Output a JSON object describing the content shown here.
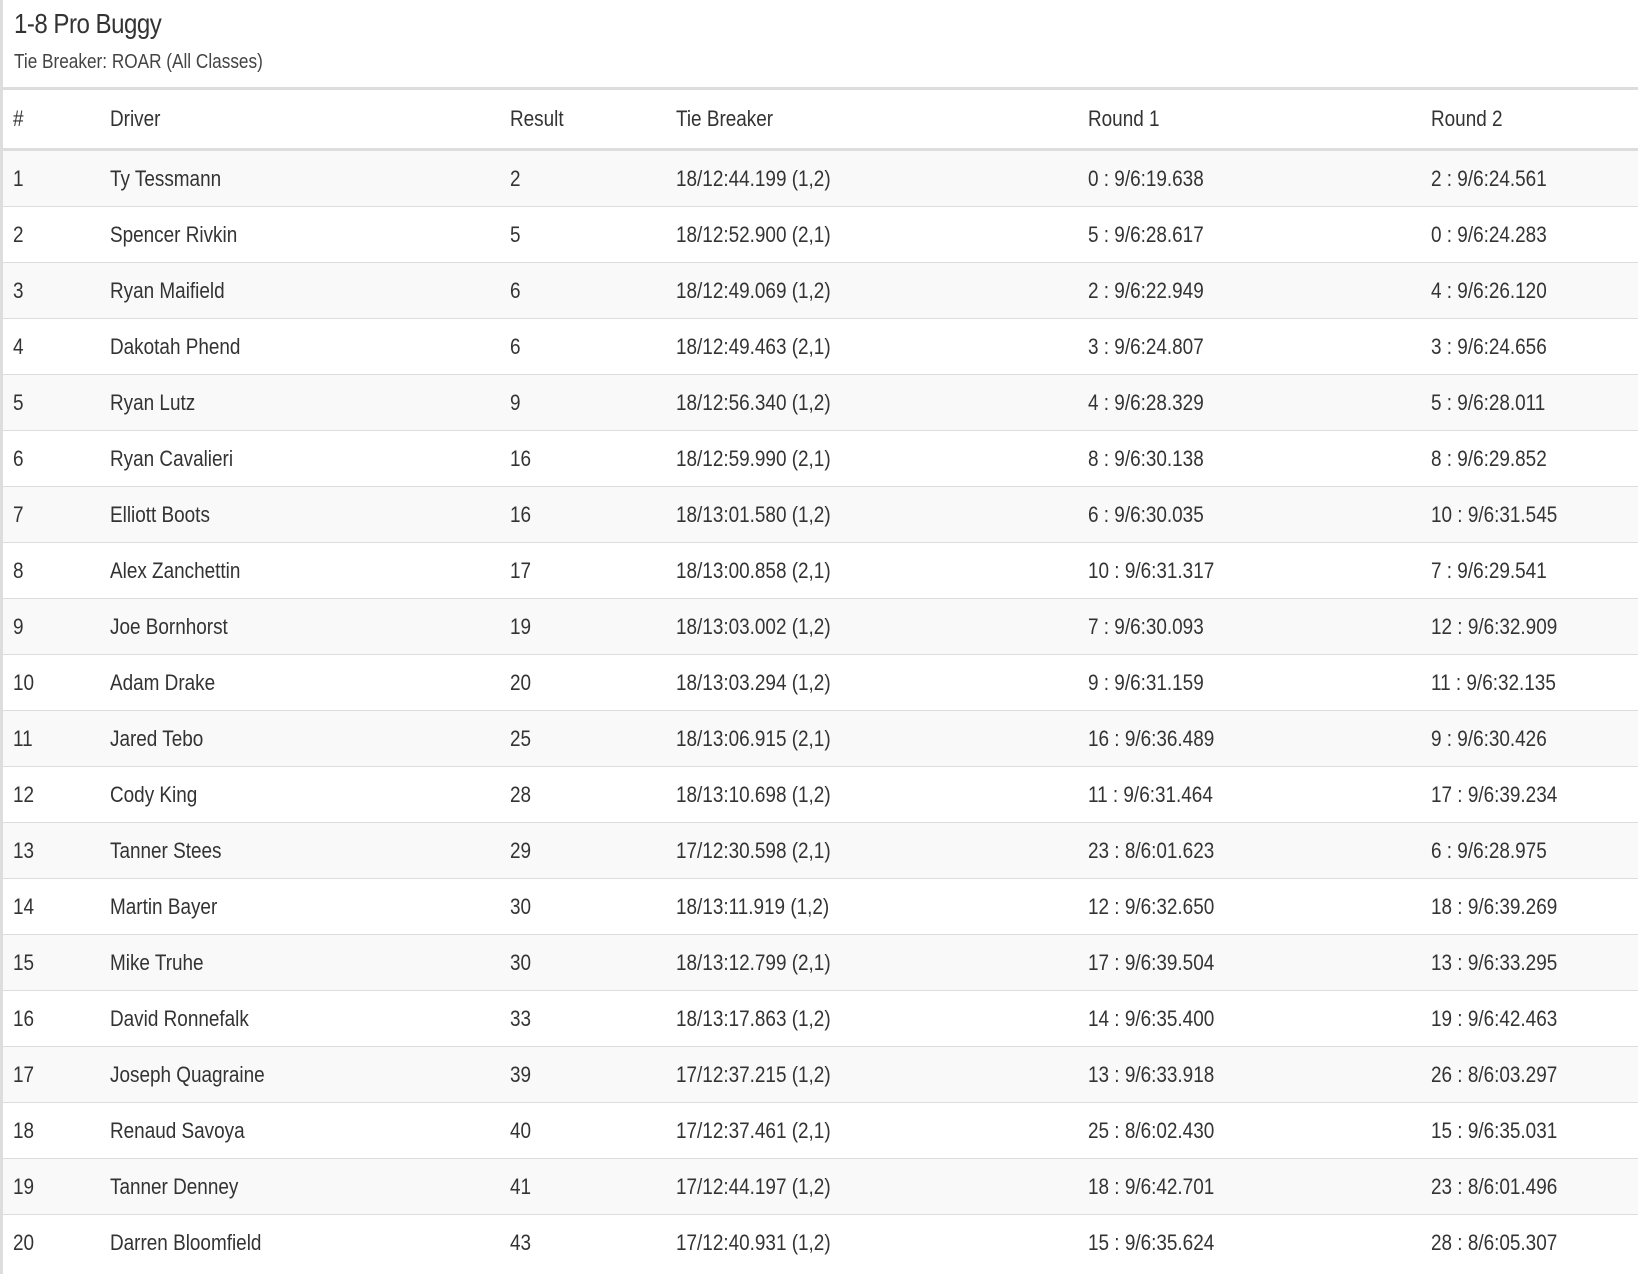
{
  "header": {
    "title": "1-8 Pro Buggy",
    "subtitle": "Tie Breaker: ROAR (All Classes)"
  },
  "table": {
    "columns": [
      "#",
      "Driver",
      "Result",
      "Tie Breaker",
      "Round 1",
      "Round 2"
    ],
    "rows": [
      [
        "1",
        "Ty Tessmann",
        "2",
        "18/12:44.199 (1,2)",
        "0 : 9/6:19.638",
        "2 : 9/6:24.561"
      ],
      [
        "2",
        "Spencer Rivkin",
        "5",
        "18/12:52.900 (2,1)",
        "5 : 9/6:28.617",
        "0 : 9/6:24.283"
      ],
      [
        "3",
        "Ryan Maifield",
        "6",
        "18/12:49.069 (1,2)",
        "2 : 9/6:22.949",
        "4 : 9/6:26.120"
      ],
      [
        "4",
        "Dakotah Phend",
        "6",
        "18/12:49.463 (2,1)",
        "3 : 9/6:24.807",
        "3 : 9/6:24.656"
      ],
      [
        "5",
        "Ryan Lutz",
        "9",
        "18/12:56.340 (1,2)",
        "4 : 9/6:28.329",
        "5 : 9/6:28.011"
      ],
      [
        "6",
        "Ryan Cavalieri",
        "16",
        "18/12:59.990 (2,1)",
        "8 : 9/6:30.138",
        "8 : 9/6:29.852"
      ],
      [
        "7",
        "Elliott Boots",
        "16",
        "18/13:01.580 (1,2)",
        "6 : 9/6:30.035",
        "10 : 9/6:31.545"
      ],
      [
        "8",
        "Alex Zanchettin",
        "17",
        "18/13:00.858 (2,1)",
        "10 : 9/6:31.317",
        "7 : 9/6:29.541"
      ],
      [
        "9",
        "Joe Bornhorst",
        "19",
        "18/13:03.002 (1,2)",
        "7 : 9/6:30.093",
        "12 : 9/6:32.909"
      ],
      [
        "10",
        "Adam Drake",
        "20",
        "18/13:03.294 (1,2)",
        "9 : 9/6:31.159",
        "11 : 9/6:32.135"
      ],
      [
        "11",
        "Jared Tebo",
        "25",
        "18/13:06.915 (2,1)",
        "16 : 9/6:36.489",
        "9 : 9/6:30.426"
      ],
      [
        "12",
        "Cody King",
        "28",
        "18/13:10.698 (1,2)",
        "11 : 9/6:31.464",
        "17 : 9/6:39.234"
      ],
      [
        "13",
        "Tanner Stees",
        "29",
        "17/12:30.598 (2,1)",
        "23 : 8/6:01.623",
        "6 : 9/6:28.975"
      ],
      [
        "14",
        "Martin Bayer",
        "30",
        "18/13:11.919 (1,2)",
        "12 : 9/6:32.650",
        "18 : 9/6:39.269"
      ],
      [
        "15",
        "Mike Truhe",
        "30",
        "18/13:12.799 (2,1)",
        "17 : 9/6:39.504",
        "13 : 9/6:33.295"
      ],
      [
        "16",
        "David Ronnefalk",
        "33",
        "18/13:17.863 (1,2)",
        "14 : 9/6:35.400",
        "19 : 9/6:42.463"
      ],
      [
        "17",
        "Joseph Quagraine",
        "39",
        "17/12:37.215 (1,2)",
        "13 : 9/6:33.918",
        "26 : 8/6:03.297"
      ],
      [
        "18",
        "Renaud Savoya",
        "40",
        "17/12:37.461 (2,1)",
        "25 : 8/6:02.430",
        "15 : 9/6:35.031"
      ],
      [
        "19",
        "Tanner Denney",
        "41",
        "17/12:44.197 (1,2)",
        "18 : 9/6:42.701",
        "23 : 8/6:01.496"
      ],
      [
        "20",
        "Darren Bloomfield",
        "43",
        "17/12:40.931 (1,2)",
        "15 : 9/6:35.624",
        "28 : 8/6:05.307"
      ]
    ]
  },
  "colors": {
    "border": "#dddddd",
    "stripe": "#f9f9f9",
    "text": "#333333"
  }
}
